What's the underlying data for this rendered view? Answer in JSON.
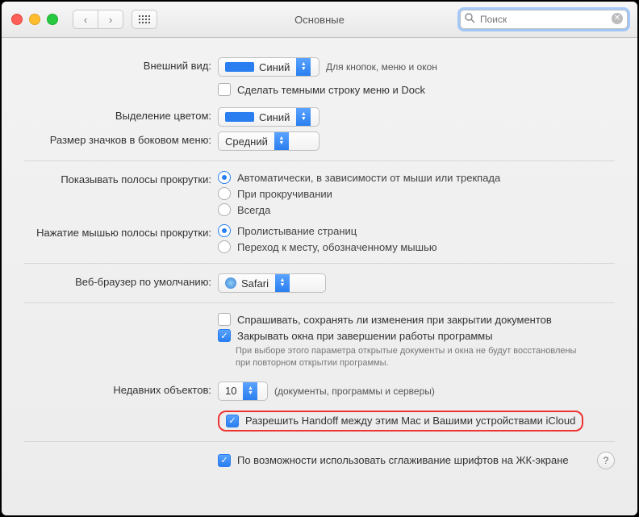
{
  "window": {
    "title": "Основные"
  },
  "search": {
    "placeholder": "Поиск"
  },
  "appearance": {
    "label": "Внешний вид:",
    "value": "Синий",
    "note": "Для кнопок, меню и окон",
    "dark_checkbox": "Сделать темными строку меню и Dock"
  },
  "highlight": {
    "label": "Выделение цветом:",
    "value": "Синий"
  },
  "sidebar_icons": {
    "label": "Размер значков в боковом меню:",
    "value": "Средний"
  },
  "scrollbars": {
    "label": "Показывать полосы прокрутки:",
    "opts": [
      "Автоматически, в зависимости от мыши или трекпада",
      "При прокручивании",
      "Всегда"
    ]
  },
  "scroll_click": {
    "label": "Нажатие мышью полосы прокрутки:",
    "opts": [
      "Пролистывание страниц",
      "Переход к месту, обозначенному мышью"
    ]
  },
  "browser": {
    "label": "Веб-браузер по умолчанию:",
    "value": "Safari"
  },
  "closing": {
    "ask": "Спрашивать, сохранять ли изменения при закрытии документов",
    "close_windows": "Закрывать окна при завершении работы программы",
    "note": "При выборе этого параметра открытые документы и окна не будут восстановлены при повторном открытии программы."
  },
  "recent": {
    "label": "Недавних объектов:",
    "value": "10",
    "suffix": "(документы, программы и серверы)"
  },
  "handoff": "Разрешить Handoff между этим Mac и Вашими устройствами iCloud",
  "font_smoothing": "По возможности использовать сглаживание шрифтов на ЖК-экране"
}
